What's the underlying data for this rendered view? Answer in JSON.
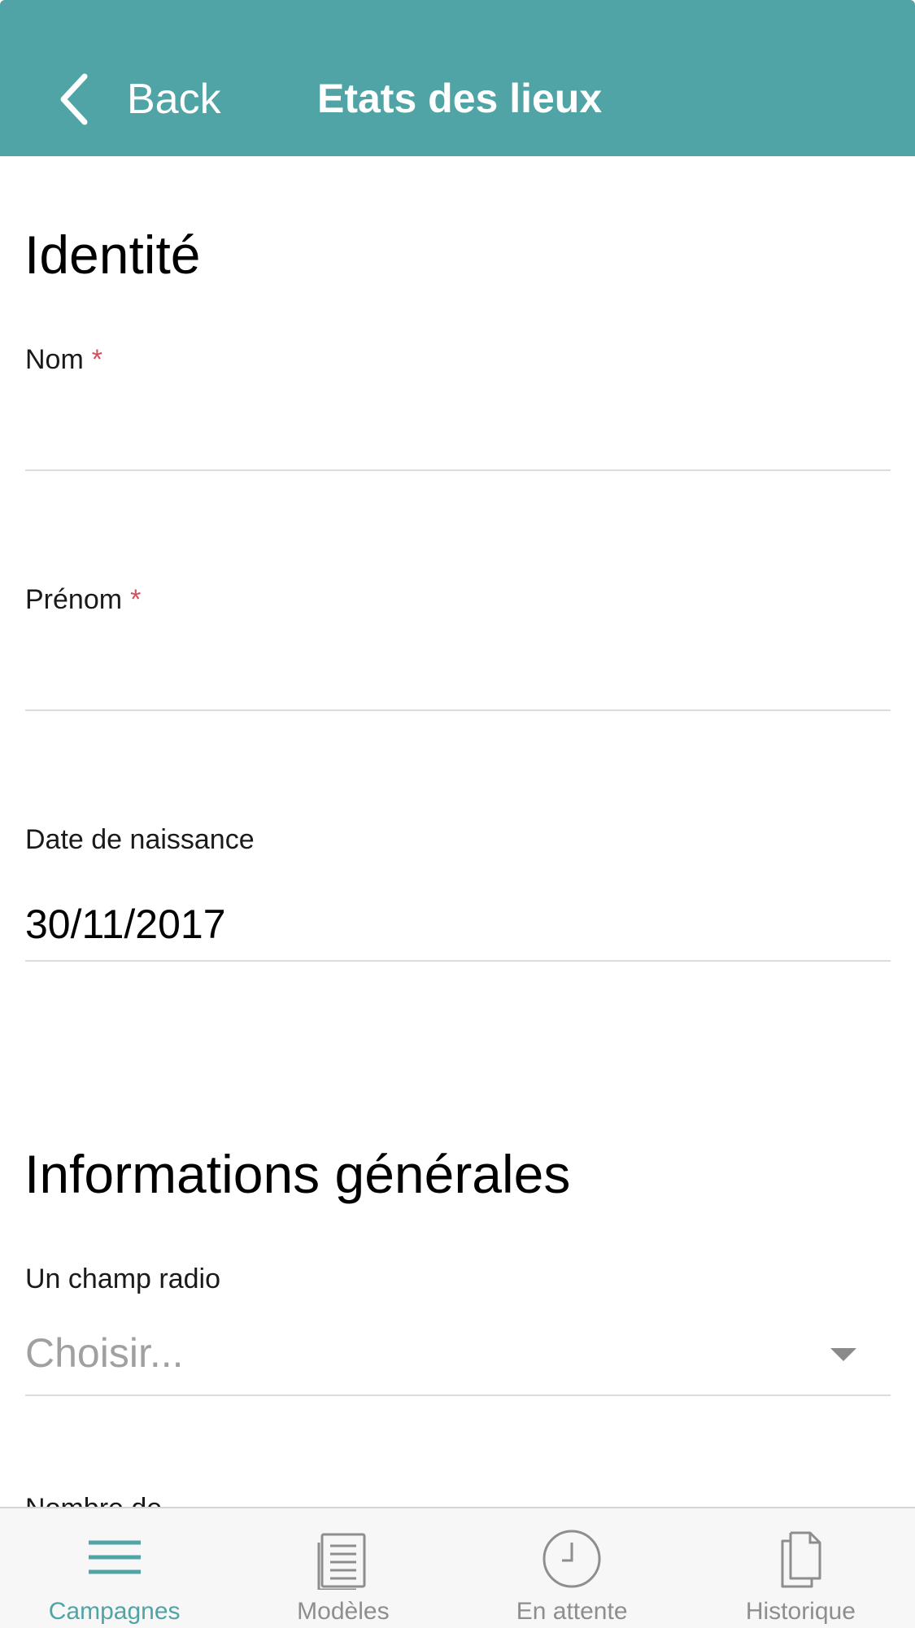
{
  "colors": {
    "accent": "#50a4a6",
    "required": "#d0505c",
    "inactive_tab": "#8e8e8e"
  },
  "navbar": {
    "back_label": "Back",
    "title": "Etats des lieux"
  },
  "sections": {
    "identite": {
      "title": "Identité",
      "fields": {
        "nom": {
          "label": "Nom",
          "required_mark": "*",
          "value": ""
        },
        "prenom": {
          "label": "Prénom",
          "required_mark": "*",
          "value": ""
        },
        "date_naissance": {
          "label": "Date de naissance",
          "value": "30/11/2017"
        }
      }
    },
    "infos": {
      "title": "Informations générales",
      "fields": {
        "radio": {
          "label": "Un champ radio",
          "placeholder": "Choisir..."
        },
        "next_label_partial": "Nombre de..."
      }
    }
  },
  "tabbar": {
    "tabs": [
      {
        "label": "Campagnes",
        "icon": "menu-icon",
        "active": true
      },
      {
        "label": "Modèles",
        "icon": "document-icon",
        "active": false
      },
      {
        "label": "En attente",
        "icon": "clock-icon",
        "active": false
      },
      {
        "label": "Historique",
        "icon": "copy-icon",
        "active": false
      }
    ]
  }
}
